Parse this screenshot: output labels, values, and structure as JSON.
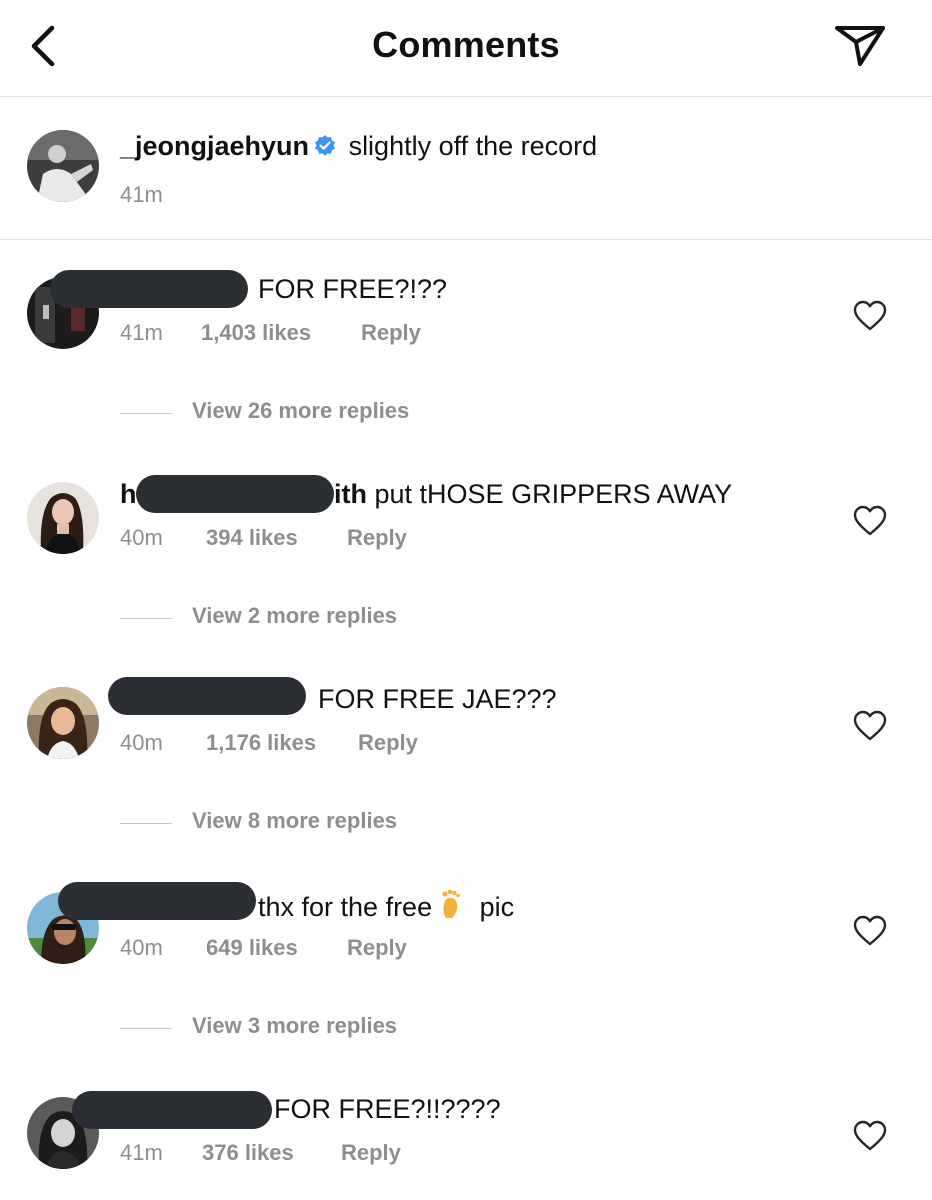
{
  "header": {
    "title": "Comments",
    "back_icon": "chevron-left-icon",
    "send_icon": "paper-plane-icon"
  },
  "caption": {
    "username": "_jeongjaehyun",
    "verified": true,
    "text": "slightly off the record",
    "time": "41m"
  },
  "comments": [
    {
      "username_visible": "",
      "text": "FOR FREE?!??",
      "time": "41m",
      "likes": "1,403 likes",
      "reply": "Reply",
      "view_replies": "View 26 more replies"
    },
    {
      "username_visible_start": "h",
      "username_visible_end": "ith",
      "text": "put tHOSE GRIPPERS AWAY",
      "time": "40m",
      "likes": "394 likes",
      "reply": "Reply",
      "view_replies": "View 2 more replies"
    },
    {
      "username_visible": "",
      "text": "FOR FREE JAE???",
      "time": "40m",
      "likes": "1,176 likes",
      "reply": "Reply",
      "view_replies": "View 8 more replies"
    },
    {
      "username_visible": "",
      "text_before": "thx for the free",
      "emoji": "foot-emoji",
      "text_after": "pic",
      "time": "40m",
      "likes": "649 likes",
      "reply": "Reply",
      "view_replies": "View 3 more replies"
    },
    {
      "username_visible": "",
      "text": "FOR FREE?!!????",
      "time": "41m",
      "likes": "376 likes",
      "reply": "Reply"
    }
  ],
  "colors": {
    "text": "#111111",
    "meta": "#8e8e8e",
    "redaction": "#2b2f33",
    "verified": "#3897f0",
    "divider": "#e3e3e3"
  }
}
